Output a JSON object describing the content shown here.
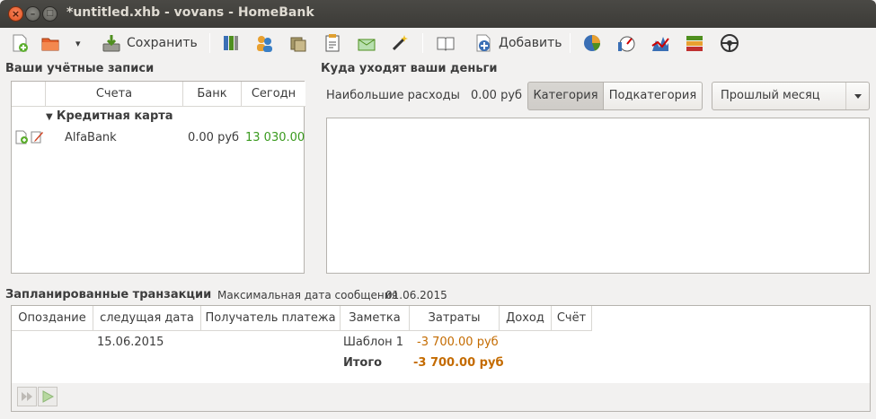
{
  "window": {
    "title": "*untitled.xhb - vovans - HomeBank",
    "close_glyph": "×",
    "minimize_glyph": "–",
    "maximize_glyph": "□"
  },
  "toolbar": {
    "save_label": "Сохранить",
    "add_label": "Добавить",
    "open_dropdown_glyph": "▾"
  },
  "accounts": {
    "title": "Ваши учётные записи",
    "columns": [
      "Счета",
      "Банк",
      "Сегодн"
    ],
    "group_label": "Кредитная карта",
    "rows": [
      {
        "name": "AlfaBank",
        "bank": "0.00 руб",
        "today": "13 030.00"
      }
    ]
  },
  "spending": {
    "title": "Куда уходят ваши деньги",
    "top_label": "Наибольшие расходы",
    "top_value": "0.00 руб",
    "segment_category": "Категория",
    "segment_subcategory": "Подкатегория",
    "period_value": "Прошлый месяц"
  },
  "scheduled": {
    "title": "Запланированные транзакции",
    "max_date_label": "Максимальная дата сообщения",
    "max_date_value": "01.06.2015",
    "columns": [
      "Опоздание",
      "следущая дата",
      "Получатель платежа",
      "Заметка",
      "Затраты",
      "Доход",
      "Счёт"
    ],
    "rows": [
      {
        "late": "",
        "next_date": "15.06.2015",
        "payee": "",
        "memo": "Шаблон 1",
        "expense": "-3 700.00 руб",
        "income": "",
        "account": ""
      }
    ],
    "total_label": "Итого",
    "total_expense": "-3 700.00 руб"
  },
  "colors": {
    "positive": "#3a9a1e",
    "expense": "#c46b00",
    "title_bar": "#3c3b37",
    "close_button": "#e2531f"
  },
  "icons": [
    "new-file-icon",
    "open-folder-icon",
    "save-icon",
    "accounts-icon",
    "payees-icon",
    "categories-icon",
    "budget-icon",
    "archives-icon",
    "assistant-wand-icon",
    "show-transactions-icon",
    "add-transaction-icon",
    "statistics-pie-icon",
    "budget-report-icon",
    "overdrawn-icon",
    "car-cost-icon",
    "vehicle-icon"
  ]
}
